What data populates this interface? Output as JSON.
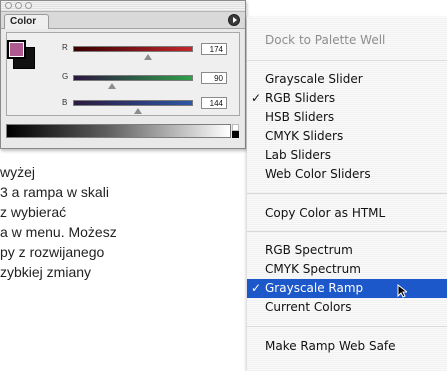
{
  "palette": {
    "tab_label": "Color",
    "foreground_color": "#ae5a90",
    "background_color": "#111111",
    "channels": [
      {
        "label": "R",
        "value": "174",
        "gradient_end": "#c2272d"
      },
      {
        "label": "G",
        "value": "90",
        "gradient_end": "#2fa04a"
      },
      {
        "label": "B",
        "value": "144",
        "gradient_end": "#2e57a6"
      }
    ]
  },
  "background_text": {
    "lines": [
      "wyżej",
      "3 a rampa w skali",
      "z wybierać",
      "a w menu. Możesz",
      "py z rozwijanego",
      "zybkiej zmiany"
    ]
  },
  "menu": {
    "accent": "#1c58c9",
    "items": [
      {
        "label": "Dock to Palette Well",
        "disabled": true
      },
      {
        "label": "Grayscale Slider"
      },
      {
        "label": "RGB Sliders",
        "checked": true
      },
      {
        "label": "HSB Sliders"
      },
      {
        "label": "CMYK Sliders"
      },
      {
        "label": "Lab Sliders"
      },
      {
        "label": "Web Color Sliders"
      },
      {
        "label": "Copy Color as HTML"
      },
      {
        "label": "RGB Spectrum"
      },
      {
        "label": "CMYK Spectrum"
      },
      {
        "label": "Grayscale Ramp",
        "checked": true,
        "selected": true
      },
      {
        "label": "Current Colors"
      },
      {
        "label": "Make Ramp Web Safe"
      }
    ],
    "check_glyph": "✓"
  }
}
